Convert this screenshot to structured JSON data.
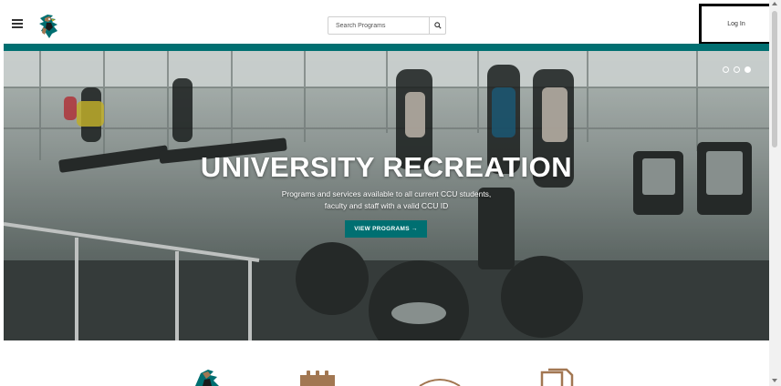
{
  "header": {
    "menu_icon": "hamburger-menu-icon",
    "logo_icon": "chanticleer-logo-icon",
    "search": {
      "placeholder": "Search Programs",
      "value": "",
      "icon": "search-icon"
    },
    "login_label": "Log In"
  },
  "colors": {
    "brand_teal": "#006f71",
    "accent_bronze": "#a27752"
  },
  "hero": {
    "title": "UNIVERSITY RECREATION",
    "subtitle_line1": "Programs and services available to all current CCU students,",
    "subtitle_line2": "faculty and staff with a valid CCU ID",
    "cta_label": "VIEW PROGRAMS →",
    "carousel": {
      "slides": 3,
      "active_slide": 3
    }
  },
  "bottom_icons": [
    "chanticleer-logo-icon",
    "calendar-icon",
    "dome-icon",
    "documents-icon"
  ]
}
